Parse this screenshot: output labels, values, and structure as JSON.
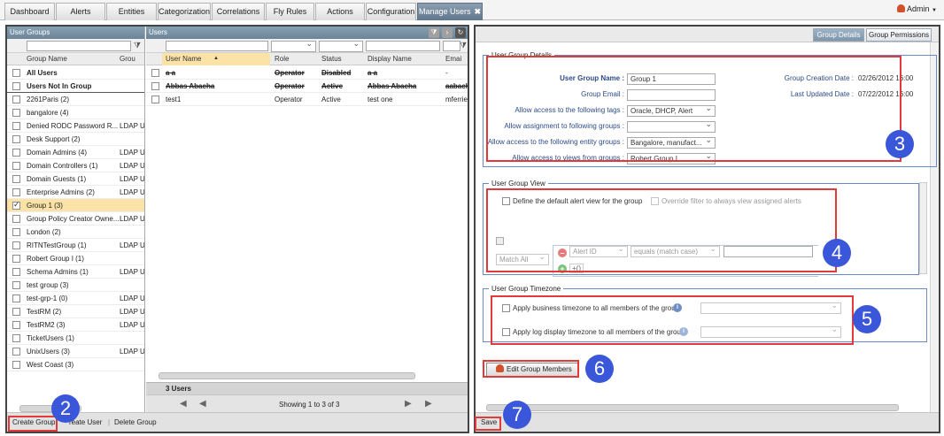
{
  "tabs": [
    {
      "label": "Dashboard"
    },
    {
      "label": "Alerts"
    },
    {
      "label": "Entities"
    },
    {
      "label": "Categorization"
    },
    {
      "label": "Correlations"
    },
    {
      "label": "Fly Rules"
    },
    {
      "label": "Actions"
    },
    {
      "label": "Configuration"
    },
    {
      "label": "Manage Users"
    }
  ],
  "tab_close": "✖",
  "user_menu": {
    "label": "Admin"
  },
  "user_groups": {
    "title": "User Groups",
    "columns": [
      "Group Name",
      "Grou"
    ],
    "rows": [
      {
        "name": "All Users",
        "type": "",
        "bold": true
      },
      {
        "name": "Users Not In Group",
        "type": "",
        "bold": true
      },
      {
        "name": "2261Paris (2)",
        "type": ""
      },
      {
        "name": "bangalore (4)",
        "type": ""
      },
      {
        "name": "Denied RODC Password R...",
        "type": "LDAP U"
      },
      {
        "name": "Desk Support (2)",
        "type": ""
      },
      {
        "name": "Domain Admins (4)",
        "type": "LDAP U"
      },
      {
        "name": "Domain Controllers (1)",
        "type": "LDAP U"
      },
      {
        "name": "Domain Guests (1)",
        "type": "LDAP U"
      },
      {
        "name": "Enterprise Admins (2)",
        "type": "LDAP U"
      },
      {
        "name": "Group 1 (3)",
        "type": "",
        "selected": true
      },
      {
        "name": "Group Policy Creator Owne...",
        "type": "LDAP U"
      },
      {
        "name": "London (2)",
        "type": ""
      },
      {
        "name": "RITNTestGroup (1)",
        "type": "LDAP U"
      },
      {
        "name": "Robert Group I (1)",
        "type": ""
      },
      {
        "name": "Schema Admins (1)",
        "type": "LDAP U"
      },
      {
        "name": "test group (3)",
        "type": ""
      },
      {
        "name": "test-grp-1 (0)",
        "type": "LDAP U"
      },
      {
        "name": "TestRM (2)",
        "type": "LDAP U"
      },
      {
        "name": "TestRM2 (3)",
        "type": "LDAP U"
      },
      {
        "name": "TicketUsers (1)",
        "type": ""
      },
      {
        "name": "UnixUsers (3)",
        "type": "LDAP U"
      },
      {
        "name": "West Coast (3)",
        "type": ""
      }
    ]
  },
  "users": {
    "title": "Users",
    "columns": [
      "User Name",
      "Role",
      "Status",
      "Display Name",
      "Emai"
    ],
    "rows": [
      {
        "user": "a a",
        "role": "Operator",
        "status": "Disabled",
        "display": "a a",
        "email": "-",
        "struck": true
      },
      {
        "user": "Abbas Abacha",
        "role": "Operator",
        "status": "Active",
        "display": "Abbas Abacha",
        "email": "aabacha",
        "struck": true
      },
      {
        "user": "test1",
        "role": "Operator",
        "status": "Active",
        "display": "test one",
        "email": "mferrie@",
        "struck": false
      }
    ],
    "count_label": "3 Users",
    "paging": "Showing 1 to 3 of 3"
  },
  "left_buttons": {
    "create_group": "Create Group",
    "create_user": "reate User",
    "delete_group": "Delete Group"
  },
  "right_tabs": {
    "details": "Group Details",
    "permissions": "Group Permissions"
  },
  "details": {
    "legend": "User Group Details",
    "name_label": "User Group Name :",
    "name_value": "Group 1",
    "email_label": "Group Email :",
    "email_value": "",
    "tags_label": "Allow access to the following tags :",
    "tags_value": "Oracle, DHCP, Alert",
    "assign_label": "Allow assignment to following groups :",
    "assign_value": "",
    "entity_label": "Allow access to the following entity groups :",
    "entity_value": "Bangalore, manufact...",
    "views_label": "Allow access to views from groups :",
    "views_value": "Robert Group I",
    "created_label": "Group Creation Date :",
    "created_value": "02/26/2012 16:00",
    "updated_label": "Last Updated Date :",
    "updated_value": "07/22/2012 16:00"
  },
  "view": {
    "legend": "User Group View",
    "define_label": "Define the default alert view for the group",
    "override_label": "Override filter to always view assigned alerts",
    "match": "Match All",
    "field": "Alert ID",
    "op": "equals (match case)",
    "value": ""
  },
  "timezone": {
    "legend": "User Group Timezone",
    "business_label": "Apply business timezone to all members of the group",
    "log_label": "Apply log display timezone to all members of the group",
    "business_value": "",
    "log_value": ""
  },
  "edit_members": "Edit Group Members",
  "save": "Save",
  "badges": {
    "b2": "2",
    "b3": "3",
    "b4": "4",
    "b5": "5",
    "b6": "6",
    "b7": "7"
  },
  "glyphs": {
    "info": "i",
    "minus": "–",
    "plus": "+",
    "add_group": "+()",
    "sort_up": "▲",
    "first": "◀",
    "prev": "◀",
    "next": "▶",
    "last": "▶",
    "dropdown": "▼"
  },
  "colors": {
    "highlight": "#e03a3a",
    "badge": "#3a56d9",
    "selected_row": "#fbe3a8",
    "panel_header": "#6b8497"
  }
}
